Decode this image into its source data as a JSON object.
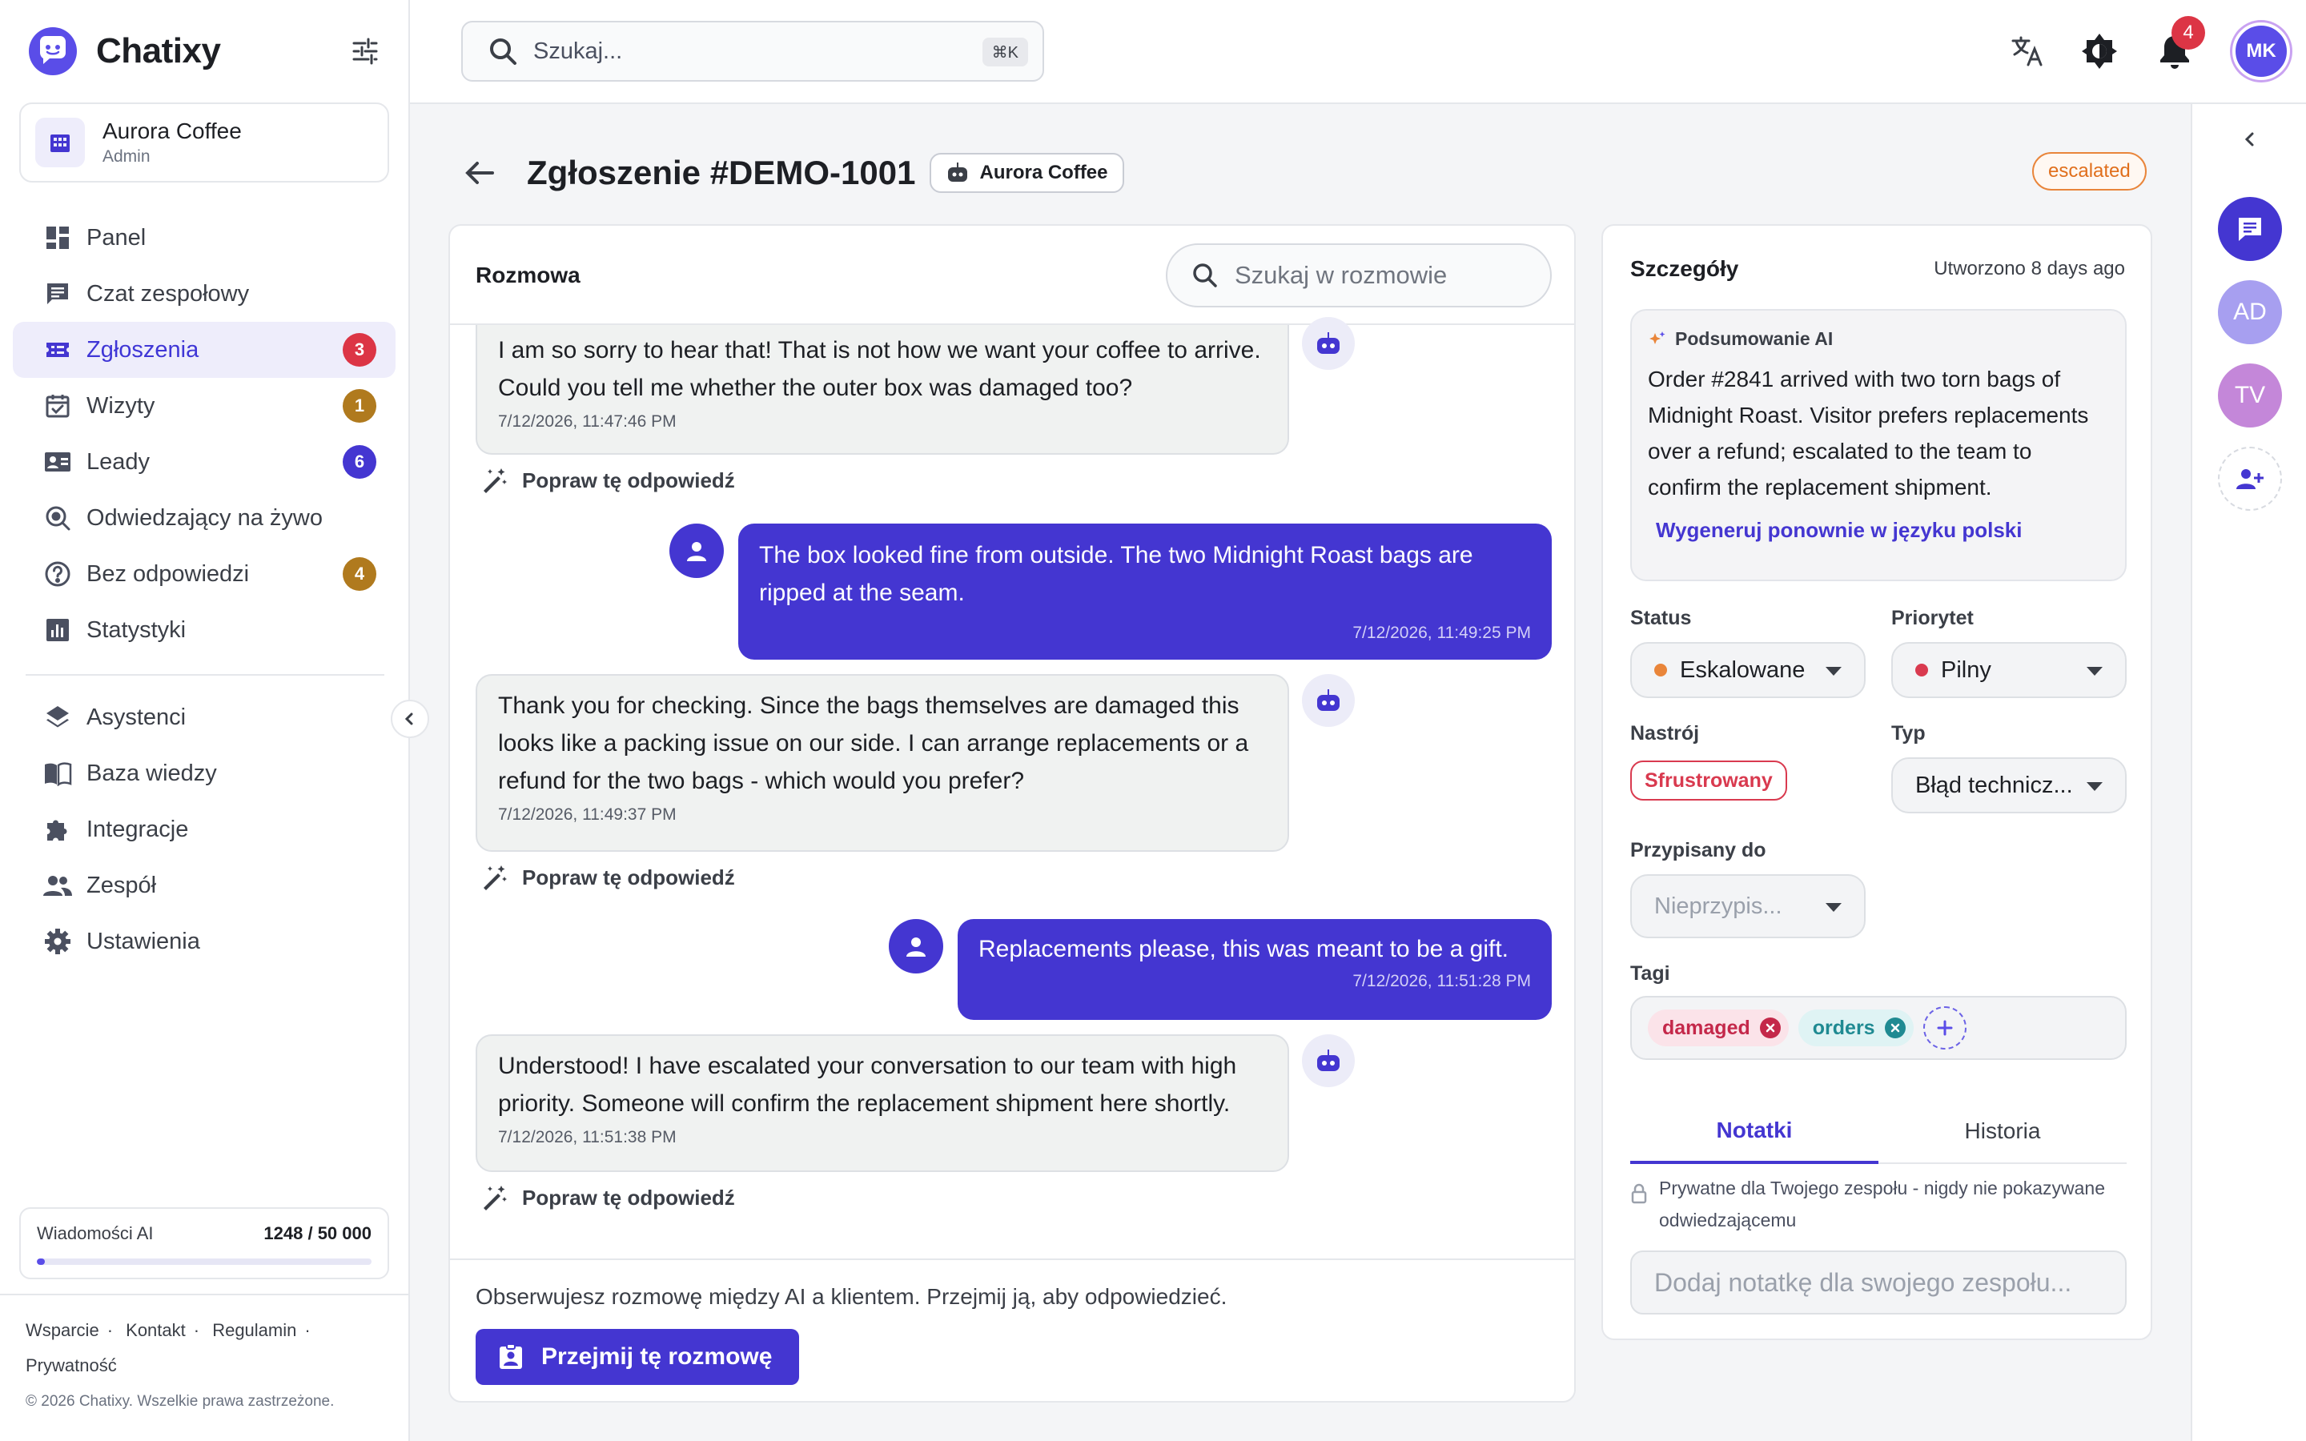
{
  "app": {
    "name": "Chatixy"
  },
  "org": {
    "name": "Aurora Coffee",
    "role": "Admin"
  },
  "nav": {
    "main": [
      {
        "label": "Panel"
      },
      {
        "label": "Czat zespołowy"
      },
      {
        "label": "Zgłoszenia",
        "badge": "3"
      },
      {
        "label": "Wizyty",
        "badge": "1"
      },
      {
        "label": "Leady",
        "badge": "6"
      },
      {
        "label": "Odwiedzający na żywo"
      },
      {
        "label": "Bez odpowiedzi",
        "badge": "4"
      },
      {
        "label": "Statystyki"
      }
    ],
    "secondary": [
      {
        "label": "Asystenci"
      },
      {
        "label": "Baza wiedzy"
      },
      {
        "label": "Integracje"
      },
      {
        "label": "Zespół"
      },
      {
        "label": "Ustawienia"
      }
    ]
  },
  "usage": {
    "label": "Wiadomości AI",
    "value": "1248 / 50 000",
    "fraction": 0.025
  },
  "footer": {
    "links": [
      "Wsparcie",
      "Kontakt",
      "Regulamin",
      "Prywatność"
    ],
    "copyright": "© 2026 Chatixy. Wszelkie prawa zastrzeżone."
  },
  "topbar": {
    "search_placeholder": "Szukaj...",
    "shortcut": "⌘K",
    "notifications_count": "4",
    "user_initials": "MK"
  },
  "ticket": {
    "title": "Zgłoszenie #DEMO-1001",
    "org_chip": "Aurora Coffee",
    "status_pill": "escalated"
  },
  "conversation": {
    "title": "Rozmowa",
    "search_placeholder": "Szukaj w rozmowie",
    "improve_label": "Popraw tę odpowiedź",
    "messages": [
      {
        "role": "ai",
        "text": "I am so sorry to hear that! That is not how we want your coffee to arrive. Could you tell me whether the outer box was damaged too?",
        "time": "7/12/2026, 11:47:46 PM"
      },
      {
        "role": "user",
        "text": "The box looked fine from outside. The two Midnight Roast bags are ripped at the seam.",
        "time": "7/12/2026, 11:49:25 PM"
      },
      {
        "role": "ai",
        "text": "Thank you for checking. Since the bags themselves are damaged this looks like a packing issue on our side. I can arrange replacements or a refund for the two bags - which would you prefer?",
        "time": "7/12/2026, 11:49:37 PM"
      },
      {
        "role": "user",
        "text": "Replacements please, this was meant to be a gift.",
        "time": "7/12/2026, 11:51:28 PM"
      },
      {
        "role": "ai",
        "text": "Understood! I have escalated your conversation to our team with high priority. Someone will confirm the replacement shipment here shortly.",
        "time": "7/12/2026, 11:51:38 PM"
      }
    ],
    "observe_text": "Obserwujesz rozmowę między AI a klientem. Przejmij ją, aby odpowiedzieć.",
    "take_over_label": "Przejmij tę rozmowę"
  },
  "details": {
    "title": "Szczegóły",
    "created": "Utworzono 8 days ago",
    "ai_summary": {
      "heading": "Podsumowanie AI",
      "text": "Order #2841 arrived with two torn bags of Midnight Roast. Visitor prefers replacements over a refund; escalated to the team to confirm the replacement shipment.",
      "regenerate": "Wygeneruj ponownie w języku polski"
    },
    "status": {
      "label": "Status",
      "value": "Eskalowane",
      "color": "#e9853a"
    },
    "priority": {
      "label": "Priorytet",
      "value": "Pilny",
      "color": "#d93a4f"
    },
    "sentiment": {
      "label": "Nastrój",
      "value": "Sfrustrowany"
    },
    "type": {
      "label": "Typ",
      "value": "Błąd technicz..."
    },
    "assigned": {
      "label": "Przypisany do",
      "value": "Nieprzypis..."
    },
    "tags": {
      "label": "Tagi",
      "items": [
        "damaged",
        "orders"
      ]
    },
    "tabs": [
      "Notatki",
      "Historia"
    ],
    "private_note": "Prywatne dla Twojego zespołu - nigdy nie pokazywane odwiedzającemu",
    "note_placeholder": "Dodaj notatkę dla swojego zespołu..."
  },
  "rail": {
    "avatars": [
      "AD",
      "TV"
    ]
  },
  "colors": {
    "accent": "#4436d1",
    "brand": "#5a4de8",
    "danger": "#dc3545",
    "orange": "#e9853a",
    "tag_pink": "#c4284a",
    "tag_teal": "#1f8a92"
  }
}
